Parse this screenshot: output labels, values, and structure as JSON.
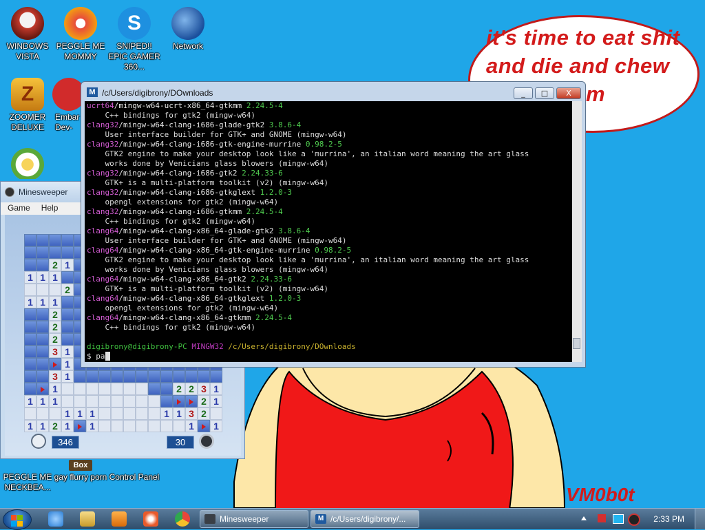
{
  "wallpaper": {
    "speech_bubble": "it's time to eat shit and die and chew ...m",
    "bubble_lines": [
      "it's time to eat shit",
      "and die and chew",
      "m"
    ],
    "signature": "VM0b0t"
  },
  "desktop_icons": [
    {
      "name": "windows-vista-icon",
      "label": "WINDOWS VISTA",
      "color": "#c0392b"
    },
    {
      "name": "peggle-me-mommy-icon",
      "label": "PEGGLE ME MOMMY",
      "color": "#e67e22"
    },
    {
      "name": "sniped-icon",
      "label": "SNIPED!! EPIC GAMER 360...",
      "color": "#1e90e0"
    },
    {
      "name": "network-icon",
      "label": "Network",
      "color": "#2c5fa8"
    },
    {
      "name": "zoomer-deluxe-icon",
      "label": "ZOOMER DELUXE",
      "color": "#e8a020"
    },
    {
      "name": "embarcadero-icon",
      "label": "Embar Dev-",
      "color": "#d12b2b"
    },
    {
      "name": "plants-icon",
      "label": "",
      "color": "#f4e3b0"
    },
    {
      "name": "peggle-neckbeard-icon",
      "label": "PEGGLE ME NECKBEA...",
      "color": "#e67e22"
    },
    {
      "name": "gay-flurry-porn-icon",
      "label": "gay flurry porn",
      "color": "#c8a060"
    },
    {
      "name": "control-panel-icon",
      "label": "Control Panel",
      "color": "#5aa0d8"
    }
  ],
  "minesweeper": {
    "title": "Minesweeper",
    "menu": [
      "Game",
      "Help"
    ],
    "timer": "346",
    "mines_left": "30",
    "grid": [
      "cccccccccccccccc",
      "cccccccccccccccc",
      "cc21cccccccccccc",
      "111ccccccccccccc",
      "ooo2cccccccccccc",
      "111ccccccccccccc",
      "cc2ccccccccccccc",
      "cc2ccccccccccccc",
      "cc2ccccccccccccc",
      "cc31cccccccccccc",
      "ccF1cccccccccccc",
      "cc31cccccccccccc",
      "cF1ooooooocc2231",
      "111oooooooocFF21",
      "ooo111ooooo1132o",
      "1121F1ooooooo1F1",
      "ooo2F11ooooo1F1c"
    ]
  },
  "terminal": {
    "title": "/c/Users/digibrony/DOwnloads",
    "window_buttons": {
      "minimize": "_",
      "maximize": "□",
      "close": "X"
    },
    "lines": [
      {
        "repo": "ucrt64",
        "pkg": "mingw-w64-ucrt-x86_64-gtkmm",
        "ver": "2.24.5-4",
        "desc": "C++ bindings for gtk2 (mingw-w64)"
      },
      {
        "repo": "clang32",
        "pkg": "mingw-w64-clang-i686-glade-gtk2",
        "ver": "3.8.6-4",
        "desc": "User interface builder for GTK+ and GNOME (mingw-w64)"
      },
      {
        "repo": "clang32",
        "pkg": "mingw-w64-clang-i686-gtk-engine-murrine",
        "ver": "0.98.2-5",
        "desc": "GTK2 engine to make your desktop look like a 'murrina', an italian word meaning the art glass",
        "desc2": "works done by Venicians glass blowers (mingw-w64)"
      },
      {
        "repo": "clang32",
        "pkg": "mingw-w64-clang-i686-gtk2",
        "ver": "2.24.33-6",
        "desc": "GTK+ is a multi-platform toolkit (v2) (mingw-w64)"
      },
      {
        "repo": "clang32",
        "pkg": "mingw-w64-clang-i686-gtkglext",
        "ver": "1.2.0-3",
        "desc": "opengl extensions for gtk2 (mingw-w64)"
      },
      {
        "repo": "clang32",
        "pkg": "mingw-w64-clang-i686-gtkmm",
        "ver": "2.24.5-4",
        "desc": "C++ bindings for gtk2 (mingw-w64)"
      },
      {
        "repo": "clang64",
        "pkg": "mingw-w64-clang-x86_64-glade-gtk2",
        "ver": "3.8.6-4",
        "desc": "User interface builder for GTK+ and GNOME (mingw-w64)"
      },
      {
        "repo": "clang64",
        "pkg": "mingw-w64-clang-x86_64-gtk-engine-murrine",
        "ver": "0.98.2-5",
        "desc": "GTK2 engine to make your desktop look like a 'murrina', an italian word meaning the art glass",
        "desc2": "works done by Venicians glass blowers (mingw-w64)"
      },
      {
        "repo": "clang64",
        "pkg": "mingw-w64-clang-x86_64-gtk2",
        "ver": "2.24.33-6",
        "desc": "GTK+ is a multi-platform toolkit (v2) (mingw-w64)"
      },
      {
        "repo": "clang64",
        "pkg": "mingw-w64-clang-x86_64-gtkglext",
        "ver": "1.2.0-3",
        "desc": "opengl extensions for gtk2 (mingw-w64)"
      },
      {
        "repo": "clang64",
        "pkg": "mingw-w64-clang-x86_64-gtkmm",
        "ver": "2.24.5-4",
        "desc": "C++ bindings for gtk2 (mingw-w64)"
      }
    ],
    "prompt": {
      "user": "digibrony@digibrony-PC",
      "system": "MINGW32",
      "dir": "/c/Users/digibrony/DOwnloads",
      "input": "$ pa"
    }
  },
  "taskbar": {
    "pinned": [
      {
        "name": "ie-icon",
        "color": "#2b7fd6"
      },
      {
        "name": "explorer-icon",
        "color": "#e8c25a"
      },
      {
        "name": "media-player-icon",
        "color": "#f08b1f"
      },
      {
        "name": "paint-icon",
        "color": "#e85a2a"
      },
      {
        "name": "chrome-icon",
        "color": "#e8453a"
      }
    ],
    "tasks": [
      {
        "label": "Minesweeper",
        "name": "task-minesweeper"
      },
      {
        "label": "/c/Users/digibrony/...",
        "name": "task-terminal"
      }
    ],
    "clock": "2:33 PM"
  }
}
